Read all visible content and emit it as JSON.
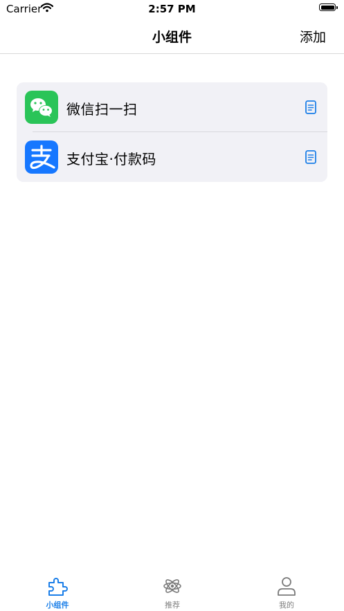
{
  "status_bar": {
    "carrier": "Carrier",
    "time": "2:57 PM"
  },
  "nav": {
    "title": "小组件",
    "add_label": "添加"
  },
  "widgets": [
    {
      "label": "微信扫一扫",
      "icon": "wechat-icon"
    },
    {
      "label": "支付宝·付款码",
      "icon": "alipay-icon"
    }
  ],
  "tabs": [
    {
      "label": "小组件",
      "icon": "puzzle-icon",
      "active": true
    },
    {
      "label": "推荐",
      "icon": "atom-icon",
      "active": false
    },
    {
      "label": "我的",
      "icon": "person-icon",
      "active": false
    }
  ],
  "colors": {
    "accent": "#1a7ee8",
    "wechat_green": "#2ac458",
    "alipay_blue": "#1677ff",
    "card_background": "#f1f1f6"
  }
}
